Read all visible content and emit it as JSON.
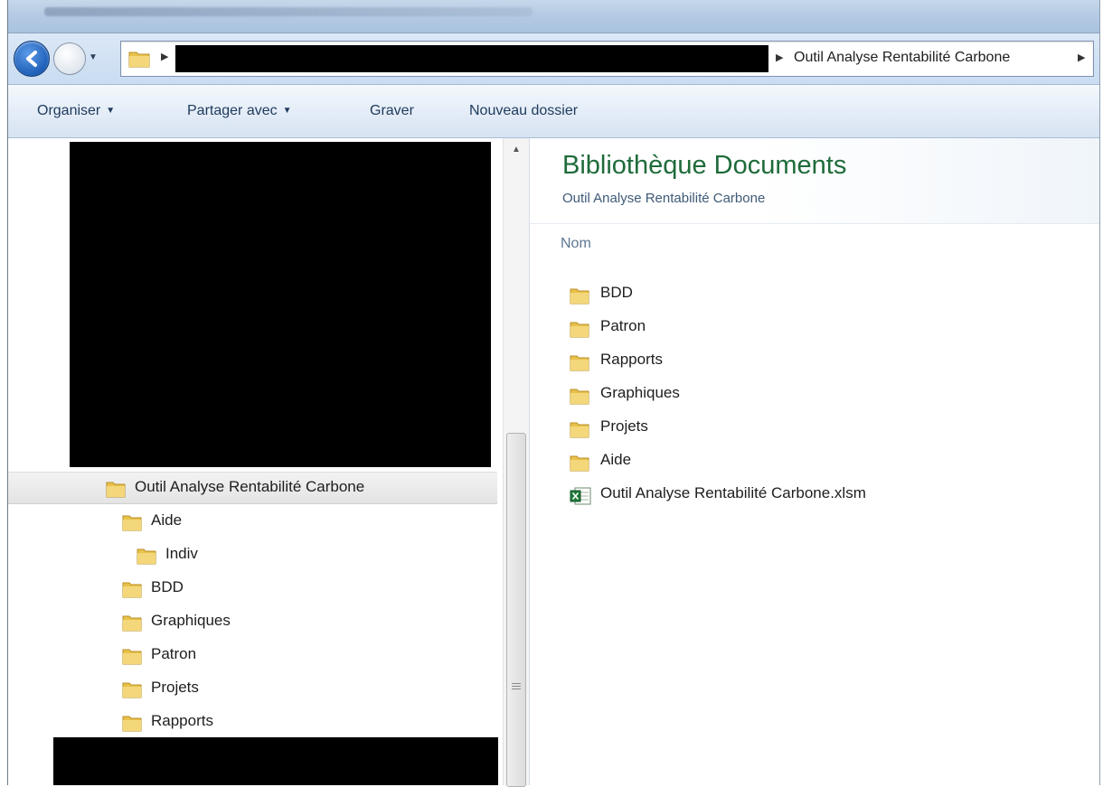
{
  "window": {
    "breadcrumb_current": "Outil Analyse Rentabilité Carbone"
  },
  "toolbar": {
    "organize_label": "Organiser",
    "share_label": "Partager avec",
    "burn_label": "Graver",
    "new_folder_label": "Nouveau dossier"
  },
  "navigation": {
    "selected_folder": "Outil Analyse Rentabilité Carbone",
    "items": [
      {
        "label": "Aide"
      },
      {
        "label": "Indiv"
      },
      {
        "label": "BDD"
      },
      {
        "label": "Graphiques"
      },
      {
        "label": "Patron"
      },
      {
        "label": "Projets"
      },
      {
        "label": "Rapports"
      }
    ]
  },
  "content": {
    "library_title": "Bibliothèque Documents",
    "library_subtitle": "Outil Analyse Rentabilité Carbone",
    "column_name": "Nom",
    "items": [
      {
        "label": "BDD",
        "icon": "folder-icon"
      },
      {
        "label": "Patron",
        "icon": "folder-icon"
      },
      {
        "label": "Rapports",
        "icon": "folder-icon"
      },
      {
        "label": "Graphiques",
        "icon": "folder-icon"
      },
      {
        "label": "Projets",
        "icon": "folder-icon"
      },
      {
        "label": "Aide",
        "icon": "folder-icon"
      },
      {
        "label": "Outil Analyse Rentabilité Carbone.xlsm",
        "icon": "excel-file-icon"
      }
    ]
  },
  "colors": {
    "library_title": "#1e6b3a",
    "folder_yellow": "#e8c14a",
    "back_button_blue": "#1d5fb8"
  }
}
